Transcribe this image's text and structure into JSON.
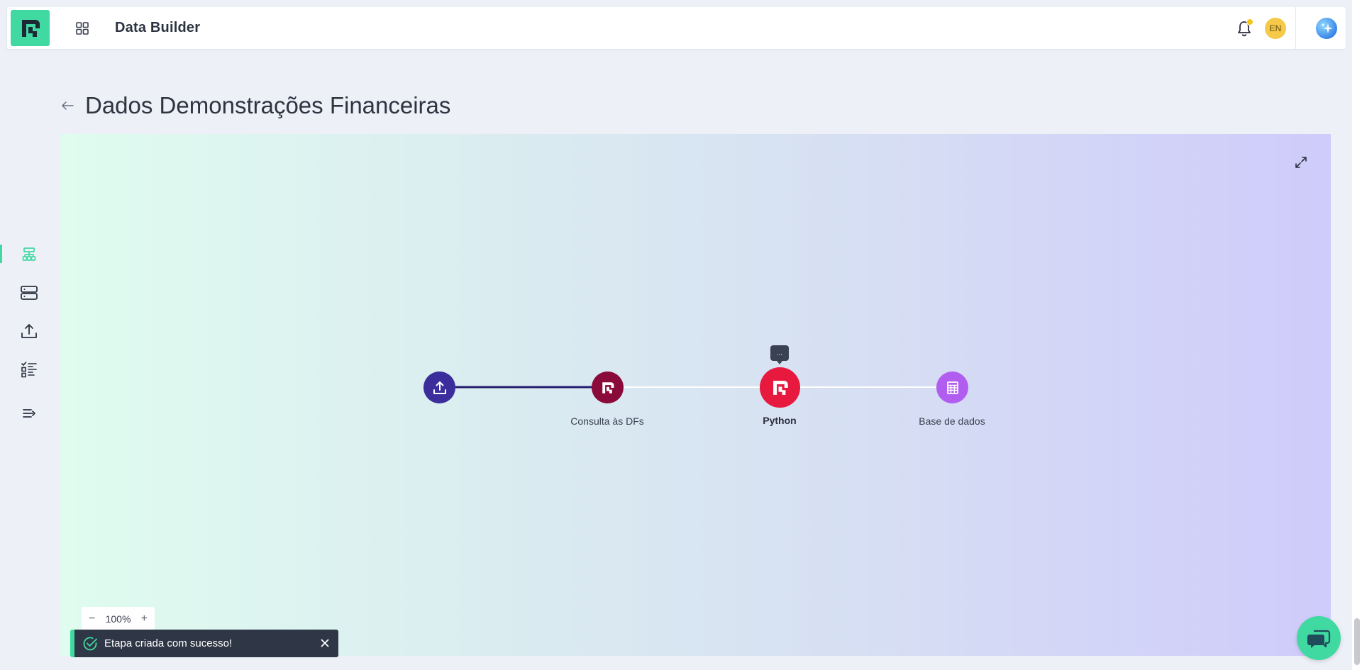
{
  "header": {
    "app_title": "Data Builder",
    "language": "EN",
    "icons": {
      "logo": "brand-logo",
      "apps": "grid-icon",
      "notifications": "bell-icon",
      "ai": "sparkle-icon"
    },
    "notification_dot_color": "#f5c518"
  },
  "sidenav": {
    "items": [
      {
        "icon": "network-tree-icon",
        "active": true
      },
      {
        "icon": "server-icon",
        "active": false
      },
      {
        "icon": "upload-icon",
        "active": false
      },
      {
        "icon": "checklist-icon",
        "active": false
      },
      {
        "icon": "collapse-icon",
        "active": false
      }
    ],
    "active_color": "#40d9a1"
  },
  "page": {
    "title": "Dados Demonstrações Financeiras"
  },
  "flow": {
    "nodes": [
      {
        "id": "upload",
        "label": "",
        "icon": "upload-icon",
        "color": "#3b2e9c"
      },
      {
        "id": "consulta",
        "label": "Consulta às DFs",
        "icon": "brand-logo",
        "color": "#8a0a3a"
      },
      {
        "id": "python",
        "label": "Python",
        "icon": "brand-logo",
        "color": "#e8193f",
        "selected": true,
        "tooltip": "..."
      },
      {
        "id": "base",
        "label": "Base de dados",
        "icon": "database-table-icon",
        "color": "#b15ef0"
      }
    ],
    "edges": [
      {
        "from": "upload",
        "to": "consulta",
        "color": "#241c6e"
      },
      {
        "from": "consulta",
        "to": "python",
        "color": "#ffffff"
      },
      {
        "from": "python",
        "to": "base",
        "color": "#ffffff"
      }
    ],
    "zoom": {
      "value": "100%",
      "minus": "−",
      "plus": "+"
    }
  },
  "toast": {
    "message": "Etapa criada com sucesso!",
    "status": "success",
    "accent_color": "#40d9a1"
  },
  "chat": {
    "icon": "chat-bubble-icon"
  }
}
